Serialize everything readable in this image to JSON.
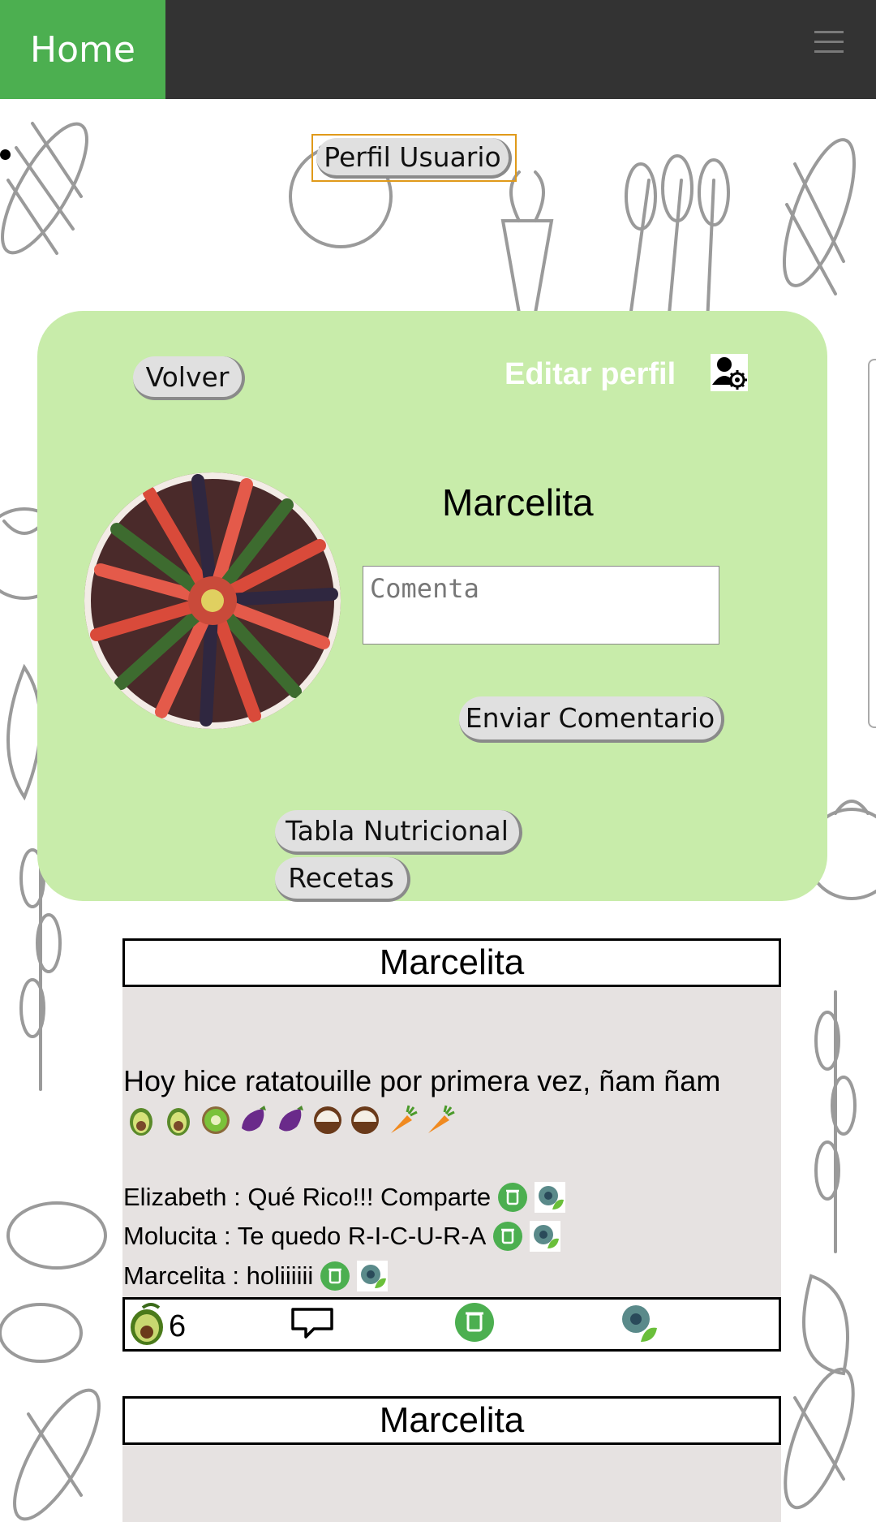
{
  "nav": {
    "home_label": "Home"
  },
  "profile_button": "Perfil Usuario",
  "card": {
    "back_label": "Volver",
    "edit_label": "Editar perfil",
    "username": "Marcelita",
    "comment_placeholder": "Comenta",
    "send_label": "Enviar Comentario",
    "nutrition_label": "Tabla Nutricional",
    "recipes_label": "Recetas"
  },
  "posts": [
    {
      "author": "Marcelita",
      "text": "Hoy hice ratatouille por primera vez, ñam ñam",
      "emojis": [
        "avocado-icon",
        "avocado-icon",
        "kiwi-icon",
        "eggplant-icon",
        "eggplant-icon",
        "coconut-icon",
        "coconut-icon",
        "carrot-icon",
        "carrot-icon"
      ],
      "comments": [
        {
          "text": "Elizabeth : Qué Rico!!! Comparte"
        },
        {
          "text": "Molucita : Te quedo R-I-C-U-R-A"
        },
        {
          "text": "Marcelita : holiiiiii"
        }
      ],
      "likes": "6"
    },
    {
      "author": "Marcelita"
    }
  ],
  "colors": {
    "nav_bg": "#333333",
    "home_bg": "#4caf50",
    "card_bg": "#c8ecaa",
    "post_bg": "#e6e2e1",
    "focus_outline": "#e09a1a"
  }
}
